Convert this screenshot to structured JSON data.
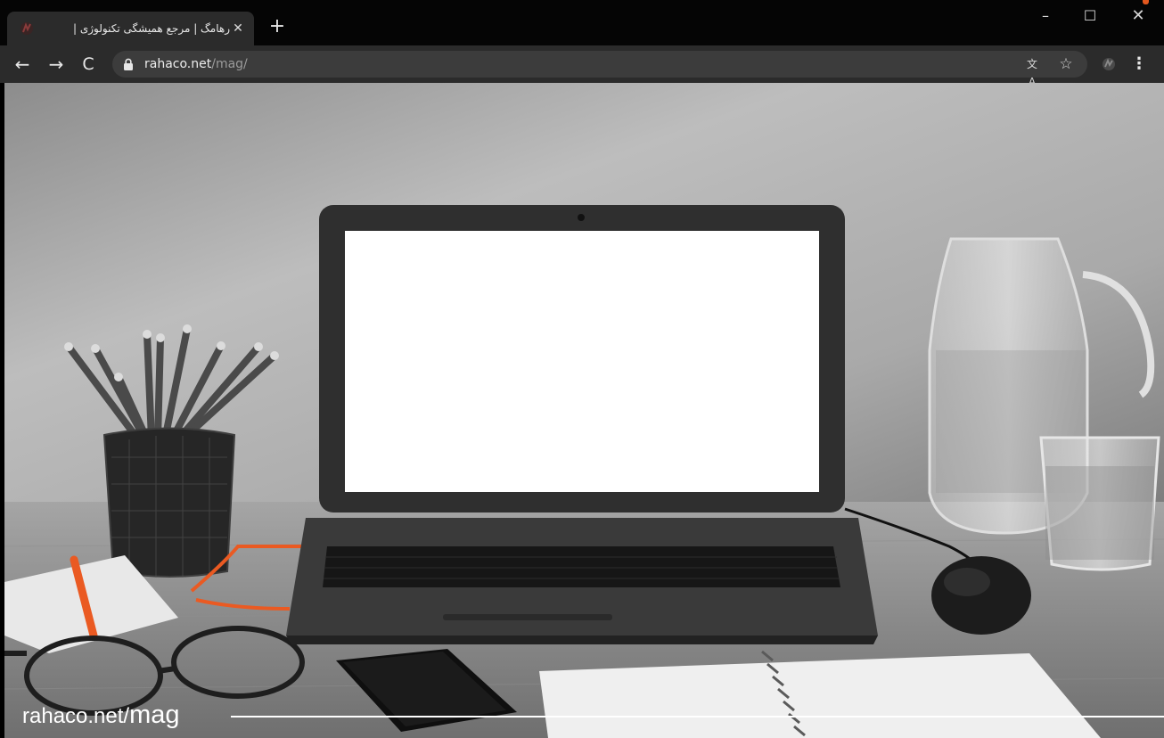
{
  "browser": {
    "tab": {
      "title": "رهامگ | مرجع همیشگی تکنولوژی |",
      "close_glyph": "✕",
      "favicon": "rahaco-favicon-icon"
    },
    "new_tab_glyph": "+",
    "window_controls": {
      "minimize": "–",
      "maximize": "☐",
      "close": "✕"
    },
    "toolbar": {
      "back_glyph": "←",
      "forward_glyph": "→",
      "reload_glyph": "C",
      "menu_glyph": "⋮",
      "translate_glyph": "文A",
      "star_glyph": "☆"
    },
    "address": {
      "domain": "rahaco.net",
      "path": "/mag/"
    },
    "colors": {
      "titlebar": "#050505",
      "toolbar": "#2b2b2b",
      "omnibox": "#3c3c3c",
      "accent": "#e2571e"
    }
  },
  "page": {
    "watermark": {
      "domain": "rahaco.net/",
      "path": "mag"
    }
  }
}
